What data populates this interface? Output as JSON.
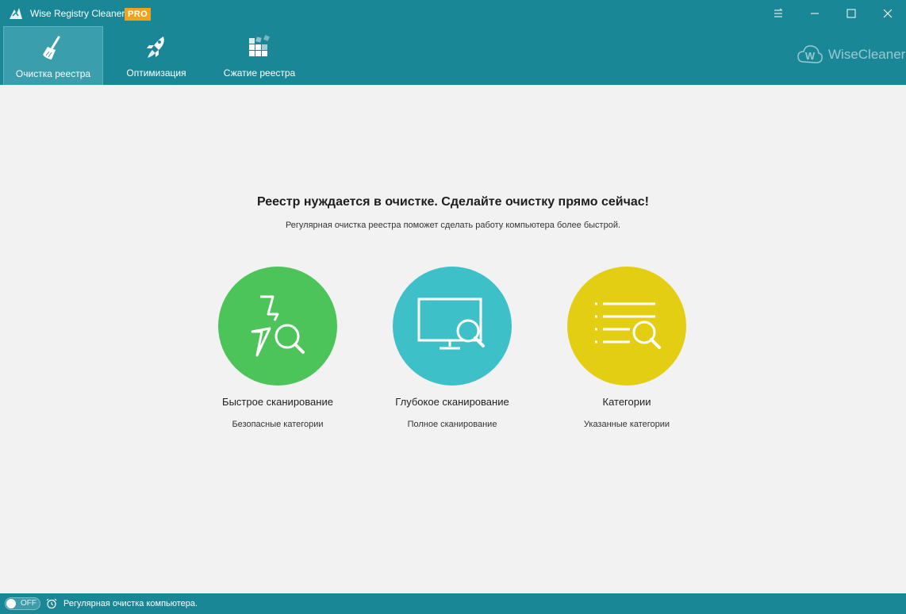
{
  "window": {
    "title": "Wise Registry Cleaner X",
    "badge": "PRO"
  },
  "tabs": [
    {
      "label": "Очистка реестра",
      "icon": "broom-icon",
      "active": true
    },
    {
      "label": "Оптимизация",
      "icon": "rocket-icon",
      "active": false
    },
    {
      "label": "Сжатие реестра",
      "icon": "blocks-icon",
      "active": false
    }
  ],
  "brand": {
    "name": "WiseCleaner",
    "logo_letter": "W"
  },
  "main": {
    "title": "Реестр нуждается в очистке. Сделайте очистку прямо сейчас!",
    "subtitle": "Регулярная очистка реестра поможет сделать работу компьютера более быстрой."
  },
  "scans": [
    {
      "title": "Быстрое сканирование",
      "subtitle": "Безопасные категории",
      "color": "#4cc459",
      "icon": "lightning-search-icon"
    },
    {
      "title": "Глубокое сканирование",
      "subtitle": "Полное сканирование",
      "color": "#3ec0c8",
      "icon": "monitor-search-icon"
    },
    {
      "title": "Категории",
      "subtitle": "Указанные категории",
      "color": "#e3ce14",
      "icon": "list-search-icon"
    }
  ],
  "status": {
    "toggle_label": "OFF",
    "toggle_on": false,
    "text": "Регулярная очистка компьютера."
  },
  "colors": {
    "header": "#1a8797",
    "background": "#f2f2f2",
    "badge": "#f5a21b"
  }
}
